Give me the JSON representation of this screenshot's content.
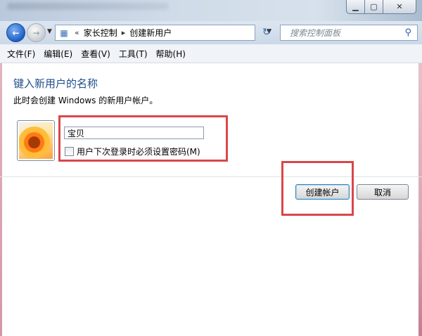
{
  "window": {
    "controls": {
      "minimize": "▁",
      "maximize": "▢",
      "close": "✕"
    }
  },
  "nav": {
    "back_icon": "arrow-left-icon",
    "forward_icon": "arrow-right-icon",
    "breadcrumb_overflow": "«",
    "breadcrumb": [
      "家长控制",
      "创建新用户"
    ],
    "separator": "▸",
    "search_placeholder": "搜索控制面板"
  },
  "menubar": {
    "items": [
      "文件(F)",
      "编辑(E)",
      "查看(V)",
      "工具(T)",
      "帮助(H)"
    ]
  },
  "content": {
    "heading": "键入新用户的名称",
    "description": "此时会创建 Windows 的新用户帐户。",
    "username_value": "宝贝",
    "require_password_label": "用户下次登录时必须设置密码(M)",
    "require_password_checked": false
  },
  "buttons": {
    "create": "创建帐户",
    "cancel": "取消"
  },
  "colors": {
    "heading": "#1e4e8c",
    "highlight_box": "#d9474b"
  }
}
